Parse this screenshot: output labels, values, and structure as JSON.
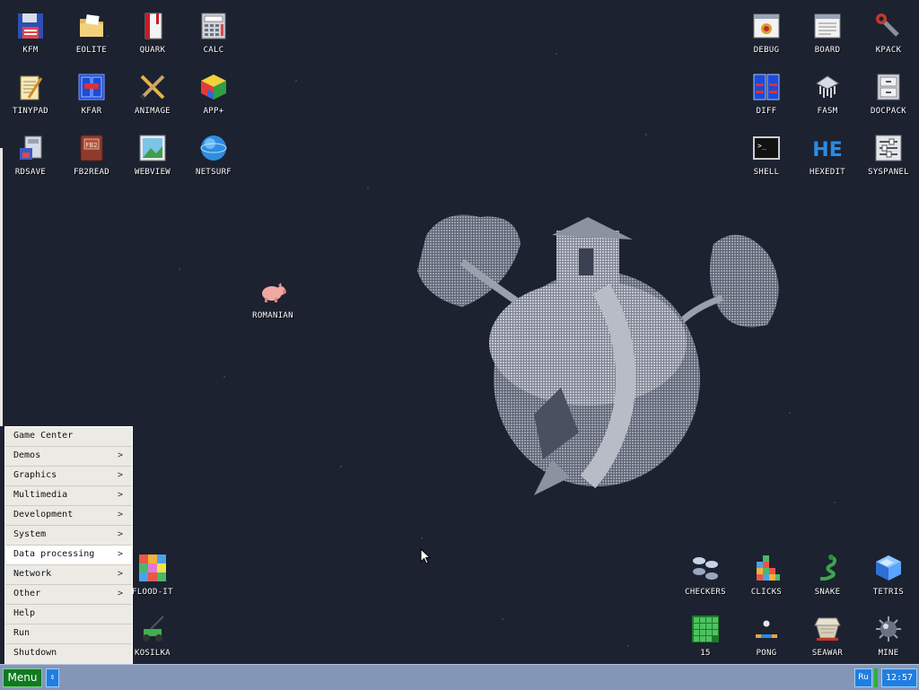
{
  "desktop": {
    "icons_top_left": [
      {
        "label": "KFM",
        "icon": "floppy-disk-icon"
      },
      {
        "label": "EOLITE",
        "icon": "folder-icon"
      },
      {
        "label": "QUARK",
        "icon": "red-book-icon"
      },
      {
        "label": "CALC",
        "icon": "calculator-icon"
      },
      {
        "label": "TINYPAD",
        "icon": "notepad-icon"
      },
      {
        "label": "KFAR",
        "icon": "dual-panel-icon"
      },
      {
        "label": "ANIMAGE",
        "icon": "pencil-brush-icon"
      },
      {
        "label": "APP+",
        "icon": "rubik-cube-icon"
      },
      {
        "label": "RDSAVE",
        "icon": "disk-save-icon"
      },
      {
        "label": "FB2READ",
        "icon": "book-fb2-icon"
      },
      {
        "label": "WEBVIEW",
        "icon": "web-picture-icon"
      },
      {
        "label": "NETSURF",
        "icon": "globe-icon"
      }
    ],
    "icons_top_right": [
      {
        "label": "DEBUG",
        "icon": "bug-window-icon"
      },
      {
        "label": "BOARD",
        "icon": "clipboard-window-icon"
      },
      {
        "label": "KPACK",
        "icon": "wrench-icon"
      },
      {
        "label": "DIFF",
        "icon": "diff-panels-icon"
      },
      {
        "label": "FASM",
        "icon": "assembler-icon"
      },
      {
        "label": "DOCPACK",
        "icon": "cabinet-icon"
      },
      {
        "label": "SHELL",
        "icon": "terminal-icon"
      },
      {
        "label": "HEXEDIT",
        "icon": "hex-editor-icon"
      },
      {
        "label": "SYSPANEL",
        "icon": "sliders-panel-icon"
      }
    ],
    "icon_romanian": {
      "label": "ROMANIAN",
      "icon": "pig-icon"
    },
    "icons_bottom_left": [
      {
        "label": "FLOOD-IT",
        "icon": "color-grid-icon"
      },
      {
        "label": "KOSILKA",
        "icon": "lawnmower-icon"
      }
    ],
    "icons_bottom_right": [
      {
        "label": "CHECKERS",
        "icon": "checkers-pieces-icon"
      },
      {
        "label": "CLICKS",
        "icon": "blocks-icon"
      },
      {
        "label": "SNAKE",
        "icon": "snake-icon"
      },
      {
        "label": "TETRIS",
        "icon": "tetris-cube-icon"
      },
      {
        "label": "15",
        "icon": "fifteen-grid-icon"
      },
      {
        "label": "PONG",
        "icon": "pong-ball-icon"
      },
      {
        "label": "SEAWAR",
        "icon": "battleship-icon"
      },
      {
        "label": "MINE",
        "icon": "mine-icon"
      }
    ]
  },
  "start_menu": {
    "items": [
      {
        "label": "Game Center",
        "submenu": false,
        "active": false
      },
      {
        "label": "Demos",
        "submenu": true,
        "active": false
      },
      {
        "label": "Graphics",
        "submenu": true,
        "active": false
      },
      {
        "label": "Multimedia",
        "submenu": true,
        "active": false
      },
      {
        "label": "Development",
        "submenu": true,
        "active": false
      },
      {
        "label": "System",
        "submenu": true,
        "active": false
      },
      {
        "label": "Data processing",
        "submenu": true,
        "active": true
      },
      {
        "label": "Network",
        "submenu": true,
        "active": false
      },
      {
        "label": "Other",
        "submenu": true,
        "active": false
      },
      {
        "label": "Help",
        "submenu": false,
        "active": false
      },
      {
        "label": "Run",
        "submenu": false,
        "active": false
      },
      {
        "label": "Shutdown",
        "submenu": false,
        "active": false
      }
    ],
    "arrow_glyph": ">"
  },
  "taskbar": {
    "menu_label": "Menu",
    "switch_glyph": "⇕",
    "language": "Ru",
    "clock": "12:57"
  },
  "colors": {
    "desktop_bg": "#1c2230",
    "taskbar_bg": "#8496b8",
    "menu_button": "#0f7a1e",
    "tray_button": "#1f7ee0"
  }
}
